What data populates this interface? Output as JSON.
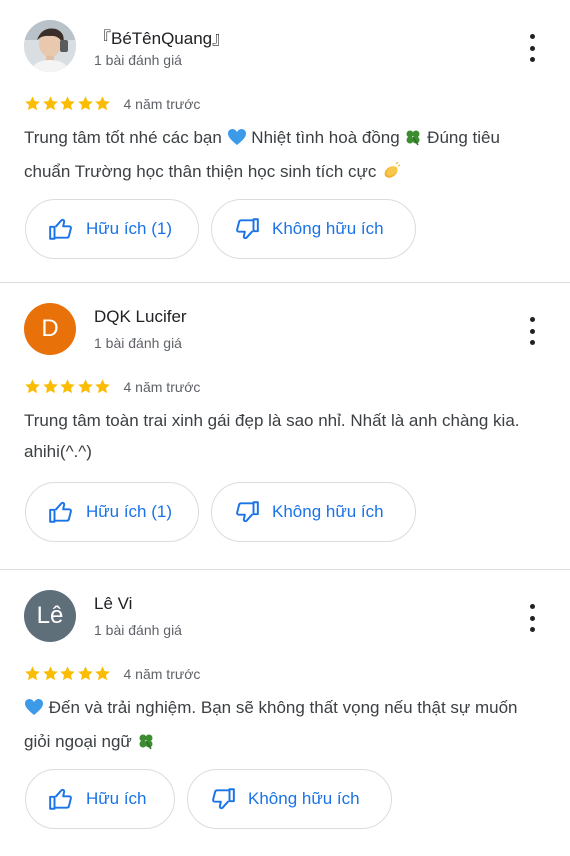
{
  "reviews": [
    {
      "name": "『BéTênQuang』",
      "review_count": "1 bài đánh giá",
      "rating": 5,
      "time": "4 năm trước",
      "text_parts": [
        "Trung tâm tốt nhé các bạn",
        "Nhiệt tình hoà đồng",
        "Đúng tiêu chuẩn Trường học thân thiện học sinh tích cực"
      ],
      "helpful_label": "Hữu ích (1)",
      "not_helpful_label": "Không hữu ích"
    },
    {
      "name": "DQK Lucifer",
      "avatar_letter": "D",
      "avatar_color": "#e8710a",
      "review_count": "1 bài đánh giá",
      "rating": 5,
      "time": "4 năm trước",
      "text": "Trung tâm toàn trai xinh gái đẹp là sao nhỉ.  Nhất là anh chàng kia. ahihi(^.^)",
      "helpful_label": "Hữu ích (1)",
      "not_helpful_label": "Không hữu ích"
    },
    {
      "name": "Lê Vi",
      "avatar_letter": "Lê",
      "avatar_color": "#5f6f7a",
      "review_count": "1 bài đánh giá",
      "rating": 5,
      "time": "4 năm trước",
      "text_parts": [
        "Đến và trải nghiệm. Bạn sẽ không thất vọng nếu thật sự muốn giỏi ngoại ngữ"
      ],
      "helpful_label": "Hữu ích",
      "not_helpful_label": "Không hữu ích"
    }
  ],
  "colors": {
    "accent": "#1a73e8",
    "star": "#fbbc04",
    "divider": "#dadce0"
  },
  "icons": [
    "thumb-up-icon",
    "thumb-down-icon",
    "more-vert-icon",
    "star-icon",
    "blue-heart-icon",
    "clover-icon",
    "clapping-hands-icon"
  ]
}
